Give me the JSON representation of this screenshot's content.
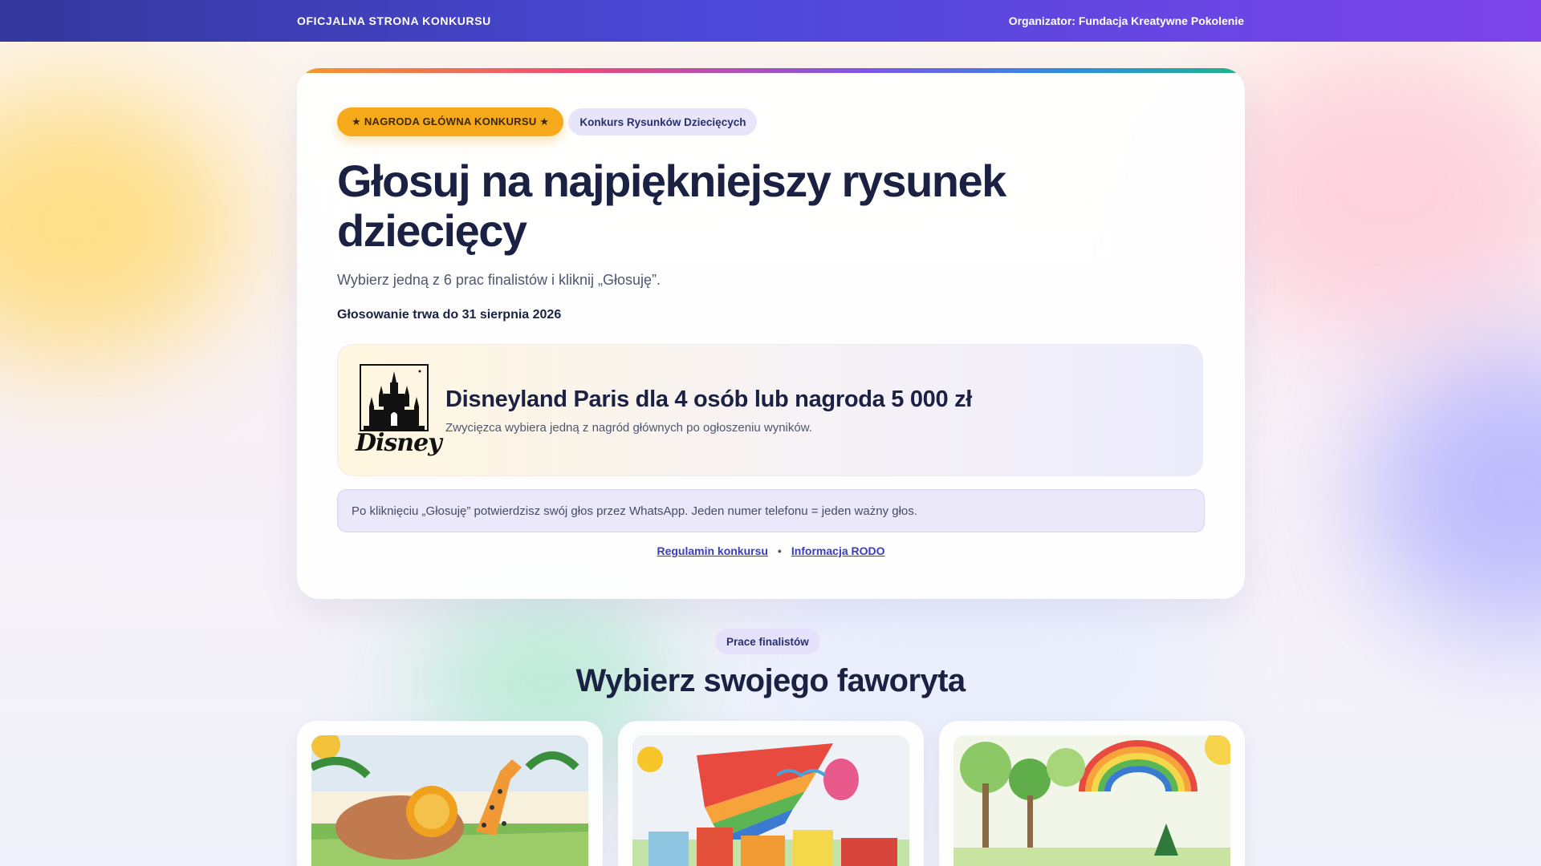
{
  "topbar": {
    "left": "OFICJALNA STRONA KONKURSU",
    "right": "Organizator: Fundacja Kreatywne Pokolenie"
  },
  "hero": {
    "badge_main": "★ NAGRODA GŁÓWNA KONKURSU ★",
    "badge_secondary": "Konkurs Rysunków Dziecięcych",
    "title": "Głosuj na najpiękniejszy rysunek dziecięcy",
    "subtitle": "Wybierz jedną z 6 prac finalistów i kliknij „Głosuję”.",
    "deadline_label": "Głosowanie trwa do ",
    "deadline_date": "31 sierpnia 2026"
  },
  "prize": {
    "logo_text": "Disney",
    "title": "Disneyland Paris dla 4 osób lub nagroda 5 000 zł",
    "description": "Zwycięzca wybiera jedną z nagród głównych po ogłoszeniu wyników."
  },
  "notice": "Po kliknięciu „Głosuję” potwierdzisz swój głos przez WhatsApp. Jeden numer telefonu = jeden ważny głos.",
  "links": {
    "rules": "Regulamin konkursu",
    "separator": "•",
    "gdpr": "Informacja RODO"
  },
  "finalists": {
    "badge": "Prace finalistów",
    "title": "Wybierz swojego faworyta",
    "cards": [
      {
        "art_icon": "lion-giraffe-drawing"
      },
      {
        "art_icon": "rainbow-town-drawing"
      },
      {
        "art_icon": "forest-rainbow-drawing"
      }
    ]
  },
  "colors": {
    "brand_gradient_start": "#34379b",
    "brand_gradient_end": "#7c44ea",
    "accent_gold": "#f6a91a",
    "link": "#3a3cc0"
  }
}
